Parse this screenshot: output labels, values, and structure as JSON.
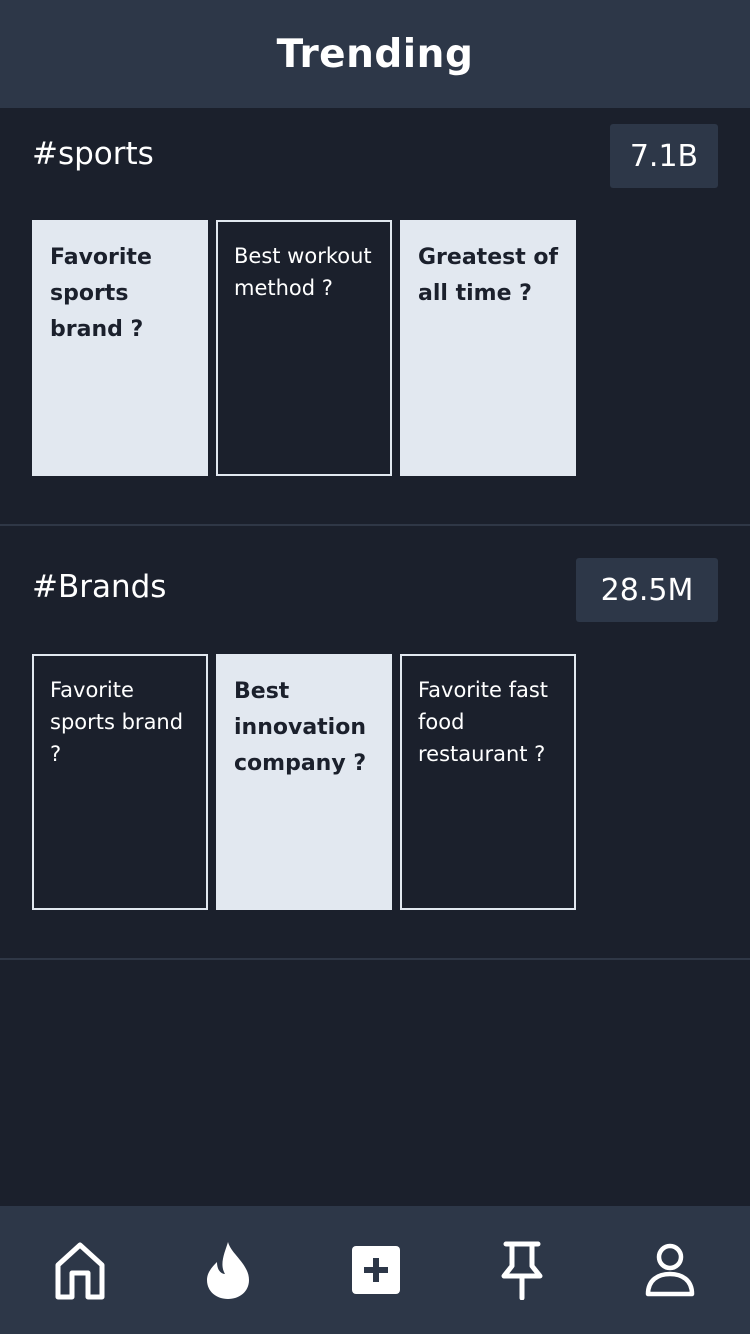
{
  "header": {
    "title": "Trending"
  },
  "sections": [
    {
      "hashtag": "#sports",
      "count": "7.1B",
      "cards": [
        {
          "text": "Favorite sports brand ?",
          "style": "light"
        },
        {
          "text": "Best workout method ?",
          "style": "dark"
        },
        {
          "text": "Greatest of all time ?",
          "style": "light"
        }
      ]
    },
    {
      "hashtag": "#Brands",
      "count": "28.5M",
      "cards": [
        {
          "text": "Favorite sports brand ?",
          "style": "dark"
        },
        {
          "text": "Best innovation company ?",
          "style": "light"
        },
        {
          "text": "Favorite fast food restaurant ?",
          "style": "dark"
        }
      ]
    }
  ],
  "nav": {
    "items": [
      {
        "icon": "home-icon"
      },
      {
        "icon": "flame-icon"
      },
      {
        "icon": "plus-square-icon"
      },
      {
        "icon": "pin-icon"
      },
      {
        "icon": "user-icon"
      }
    ]
  },
  "colors": {
    "background": "#1b202c",
    "header_bg": "#2d3748",
    "card_light": "#e2e8f0",
    "text_light": "#ffffff"
  }
}
